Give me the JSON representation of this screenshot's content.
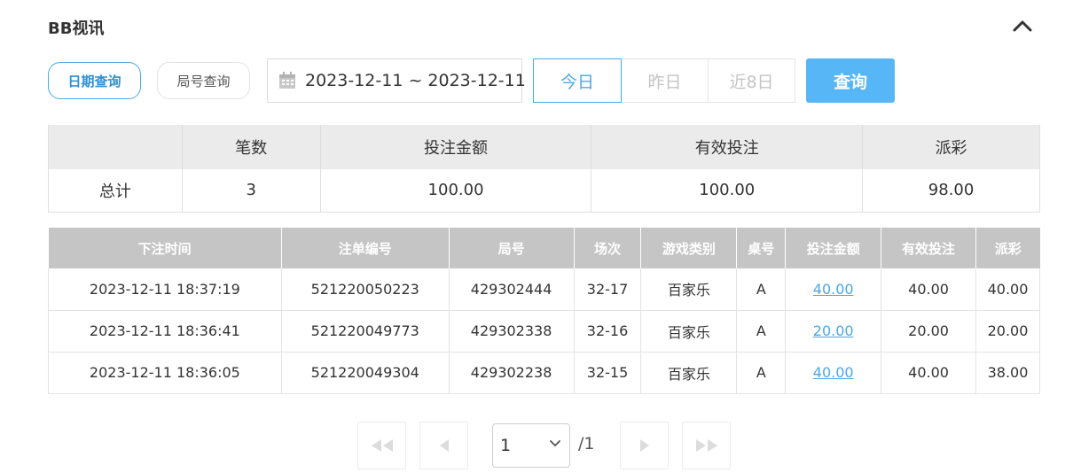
{
  "header": {
    "title": "BB视讯"
  },
  "tabs": {
    "date_query": "日期查询",
    "round_query": "局号查询"
  },
  "date_range": {
    "value": "2023-12-11 ~ 2023-12-11"
  },
  "quick_filters": [
    {
      "label": "今日",
      "active": true
    },
    {
      "label": "昨日",
      "active": false
    },
    {
      "label": "近8日",
      "active": false
    }
  ],
  "search_button": {
    "label": "查询"
  },
  "summary": {
    "headers": [
      "",
      "笔数",
      "投注金额",
      "有效投注",
      "派彩"
    ],
    "row": [
      "总计",
      "3",
      "100.00",
      "100.00",
      "98.00"
    ]
  },
  "records": {
    "headers": [
      "下注时间",
      "注单编号",
      "局号",
      "场次",
      "游戏类别",
      "桌号",
      "投注金额",
      "有效投注",
      "派彩"
    ],
    "rows": [
      [
        "2023-12-11 18:37:19",
        "521220050223",
        "429302444",
        "32-17",
        "百家乐",
        "A",
        "40.00",
        "40.00",
        "40.00"
      ],
      [
        "2023-12-11 18:36:41",
        "521220049773",
        "429302338",
        "32-16",
        "百家乐",
        "A",
        "20.00",
        "20.00",
        "20.00"
      ],
      [
        "2023-12-11 18:36:05",
        "521220049304",
        "429302238",
        "32-15",
        "百家乐",
        "A",
        "40.00",
        "40.00",
        "38.00"
      ]
    ]
  },
  "pagination": {
    "current": "1",
    "total": "/1"
  },
  "colors": {
    "accent": "#4aa8e8",
    "button": "#57b6f5",
    "header_bg": "#c5c5c5"
  }
}
